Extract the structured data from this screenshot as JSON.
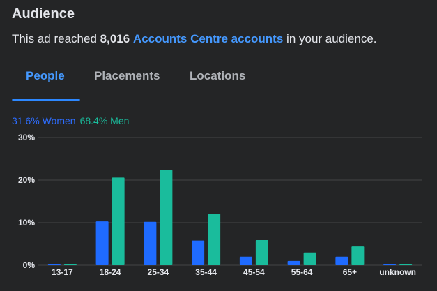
{
  "header": {
    "title": "Audience"
  },
  "reach": {
    "prefix": "This ad reached ",
    "count": "8,016",
    "link_text": "Accounts Centre accounts",
    "suffix": " in your audience."
  },
  "tabs": [
    {
      "label": "People",
      "active": true
    },
    {
      "label": "Placements",
      "active": false
    },
    {
      "label": "Locations",
      "active": false
    }
  ],
  "gender_split": {
    "women_label": "31.6% Women",
    "men_label": "68.4% Men"
  },
  "colors": {
    "women": "#1f6bff",
    "men": "#1abc9c",
    "grid": "#3a3b3c",
    "text": "#e4e6eb"
  },
  "chart_data": {
    "type": "bar",
    "categories": [
      "13-17",
      "18-24",
      "25-34",
      "35-44",
      "45-54",
      "55-64",
      "65+",
      "unknown"
    ],
    "series": [
      {
        "name": "Women",
        "values": [
          0.2,
          10.3,
          10.2,
          5.8,
          2.0,
          1.0,
          2.0,
          0.0
        ]
      },
      {
        "name": "Men",
        "values": [
          0.2,
          20.6,
          22.4,
          12.1,
          5.9,
          3.0,
          4.4,
          0.1
        ]
      }
    ],
    "ylim": [
      0,
      30
    ],
    "yticks": [
      0,
      10,
      20,
      30
    ],
    "ytick_labels": [
      "0%",
      "10%",
      "20%",
      "30%"
    ],
    "grid": true
  }
}
